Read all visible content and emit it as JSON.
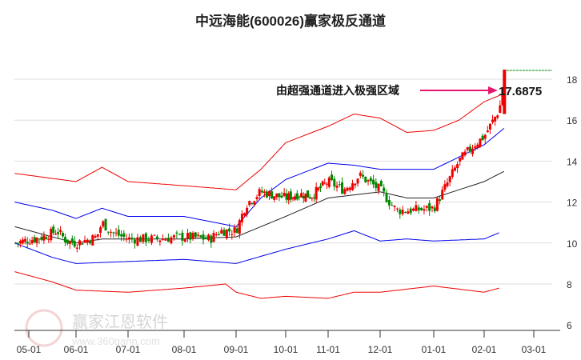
{
  "title": "中远海能(600026)赢家极反通道",
  "watermark": {
    "brand": "赢家江恩软件",
    "url": "www.360gann.com",
    "seal": "江赢恩家"
  },
  "colors": {
    "up": "#ee0000",
    "down": "#008800",
    "ma": "#222222",
    "blue": "#0000ee",
    "red": "#ee0000",
    "arrow": "#e8146e"
  },
  "chart_data": {
    "type": "candlestick",
    "title": "中远海能(600026)赢家极反通道",
    "x_ticks": [
      "05-01",
      "06-01",
      "07-01",
      "08-01",
      "09-01",
      "10-01",
      "11-01",
      "12-01",
      "01-01",
      "02-01",
      "03-01"
    ],
    "y_ticks": [
      6,
      8,
      10,
      12,
      14,
      16,
      18
    ],
    "ylim": [
      6,
      19
    ],
    "annotation": {
      "text": "由超强通道进入极强区域",
      "value": "17.6875"
    },
    "price_path": [
      [
        -0.3,
        10.0
      ],
      [
        0.3,
        10.3
      ],
      [
        0.6,
        10.6
      ],
      [
        0.8,
        10.1
      ],
      [
        1.0,
        10.0
      ],
      [
        1.4,
        10.3
      ],
      [
        1.5,
        11.0
      ],
      [
        1.7,
        10.5
      ],
      [
        2.0,
        10.2
      ],
      [
        2.5,
        10.2
      ],
      [
        3.0,
        10.3
      ],
      [
        3.5,
        10.2
      ],
      [
        3.7,
        10.6
      ],
      [
        4.0,
        10.6
      ],
      [
        4.2,
        11.9
      ],
      [
        4.5,
        12.5
      ],
      [
        5.0,
        12.2
      ],
      [
        5.3,
        12.4
      ],
      [
        5.6,
        12.3
      ],
      [
        6.0,
        13.0
      ],
      [
        6.3,
        12.6
      ],
      [
        6.6,
        13.3
      ],
      [
        7.0,
        12.6
      ],
      [
        7.3,
        11.6
      ],
      [
        7.6,
        11.6
      ],
      [
        8.0,
        11.7
      ],
      [
        8.2,
        12.6
      ],
      [
        8.5,
        14.0
      ],
      [
        8.8,
        14.8
      ],
      [
        9.0,
        15.2
      ],
      [
        9.3,
        16.5
      ],
      [
        9.4,
        17.6
      ]
    ],
    "series": [
      {
        "name": "ma",
        "color": "ma",
        "values": [
          [
            -0.3,
            10.8
          ],
          [
            0.5,
            10.3
          ],
          [
            1,
            10.0
          ],
          [
            1.5,
            10.2
          ],
          [
            2,
            10.2
          ],
          [
            3,
            10.2
          ],
          [
            4,
            10.3
          ],
          [
            5,
            11.3
          ],
          [
            6,
            12.2
          ],
          [
            7,
            12.5
          ],
          [
            7.5,
            12.2
          ],
          [
            8,
            12.2
          ],
          [
            8.5,
            12.6
          ],
          [
            9,
            13.0
          ],
          [
            9.4,
            13.5
          ]
        ]
      },
      {
        "name": "blue-upper",
        "color": "blue",
        "values": [
          [
            -0.3,
            12.0
          ],
          [
            0.5,
            11.6
          ],
          [
            1,
            11.2
          ],
          [
            1.5,
            11.7
          ],
          [
            2,
            11.3
          ],
          [
            3,
            11.3
          ],
          [
            4,
            10.8
          ],
          [
            4.5,
            12.2
          ],
          [
            5,
            13.1
          ],
          [
            6,
            13.9
          ],
          [
            6.5,
            13.8
          ],
          [
            7,
            13.6
          ],
          [
            8,
            13.6
          ],
          [
            8.5,
            14.2
          ],
          [
            9,
            14.8
          ],
          [
            9.4,
            15.6
          ]
        ]
      },
      {
        "name": "blue-lower",
        "color": "blue",
        "values": [
          [
            -0.3,
            10.0
          ],
          [
            0.5,
            9.3
          ],
          [
            1,
            9.0
          ],
          [
            2,
            9.1
          ],
          [
            3,
            9.2
          ],
          [
            4,
            9.0
          ],
          [
            5,
            9.7
          ],
          [
            6,
            10.2
          ],
          [
            6.5,
            10.6
          ],
          [
            7,
            10.1
          ],
          [
            7.5,
            10.2
          ],
          [
            8,
            10.1
          ],
          [
            9,
            10.2
          ],
          [
            9.3,
            10.5
          ]
        ]
      },
      {
        "name": "red-upper",
        "color": "red",
        "values": [
          [
            -0.3,
            13.4
          ],
          [
            1,
            13.0
          ],
          [
            1.5,
            13.7
          ],
          [
            2,
            13.0
          ],
          [
            3,
            12.8
          ],
          [
            4,
            12.6
          ],
          [
            4.5,
            13.6
          ],
          [
            5,
            14.9
          ],
          [
            6,
            15.7
          ],
          [
            6.5,
            16.3
          ],
          [
            7,
            16.1
          ],
          [
            7.5,
            15.4
          ],
          [
            8,
            15.5
          ],
          [
            8.5,
            16.0
          ],
          [
            9,
            16.9
          ],
          [
            9.4,
            17.3
          ]
        ]
      },
      {
        "name": "red-lower",
        "color": "red",
        "values": [
          [
            -0.3,
            8.6
          ],
          [
            0.5,
            8.1
          ],
          [
            1,
            7.7
          ],
          [
            2,
            7.6
          ],
          [
            3,
            7.8
          ],
          [
            3.8,
            8.0
          ],
          [
            4,
            7.6
          ],
          [
            4.5,
            7.3
          ],
          [
            5,
            7.4
          ],
          [
            6,
            7.3
          ],
          [
            6.5,
            7.6
          ],
          [
            7,
            7.6
          ],
          [
            8,
            7.9
          ],
          [
            9,
            7.6
          ],
          [
            9.3,
            7.8
          ]
        ]
      }
    ]
  }
}
